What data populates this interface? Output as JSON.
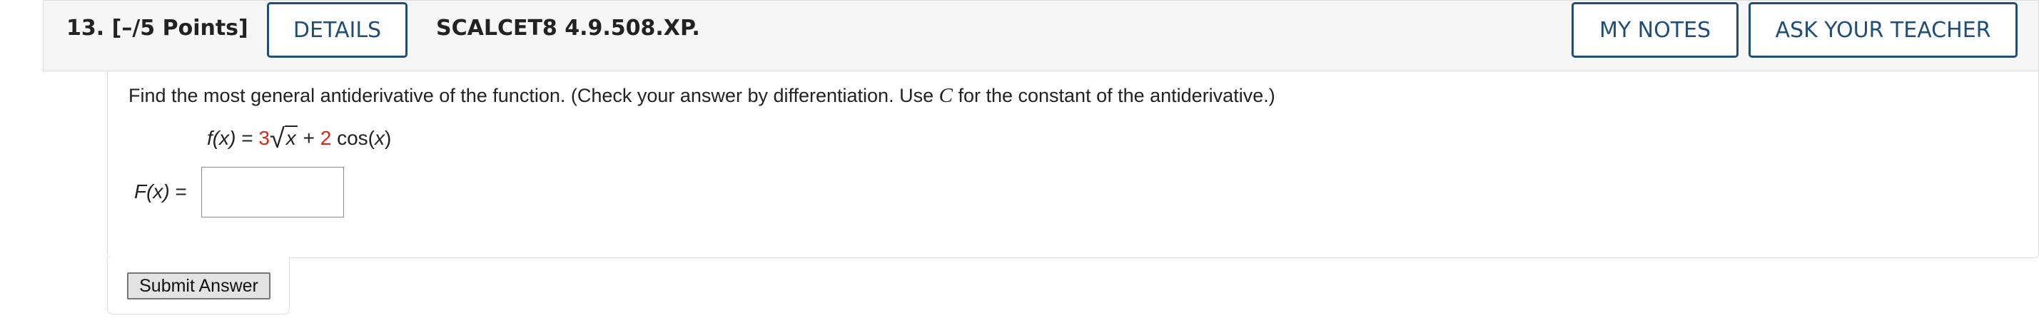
{
  "header": {
    "question_number": "13.",
    "points": "[–/5 Points]",
    "details_button": "DETAILS",
    "question_code": "SCALCET8 4.9.508.XP.",
    "my_notes_button": "MY NOTES",
    "ask_teacher_button": "ASK YOUR TEACHER"
  },
  "question": {
    "instructions_pre": "Find the most general antiderivative of the function. (Check your answer by differentiation. Use ",
    "constant_symbol": "C",
    "instructions_post": " for the constant of the antiderivative.)",
    "function_lhs": "f(x)",
    "equals": " = ",
    "coef1": "3",
    "radicand": "x",
    "plus": " + ",
    "coef2": "2",
    "trig": " cos(",
    "trig_arg": "x",
    "trig_close": ")"
  },
  "answer": {
    "label": "F(x)",
    "equals": " =",
    "value": ""
  },
  "submit_button": "Submit Answer",
  "colors": {
    "accent": "#1f4e79",
    "highlight_red": "#d42a1b",
    "header_bg": "#f6f6f6"
  }
}
